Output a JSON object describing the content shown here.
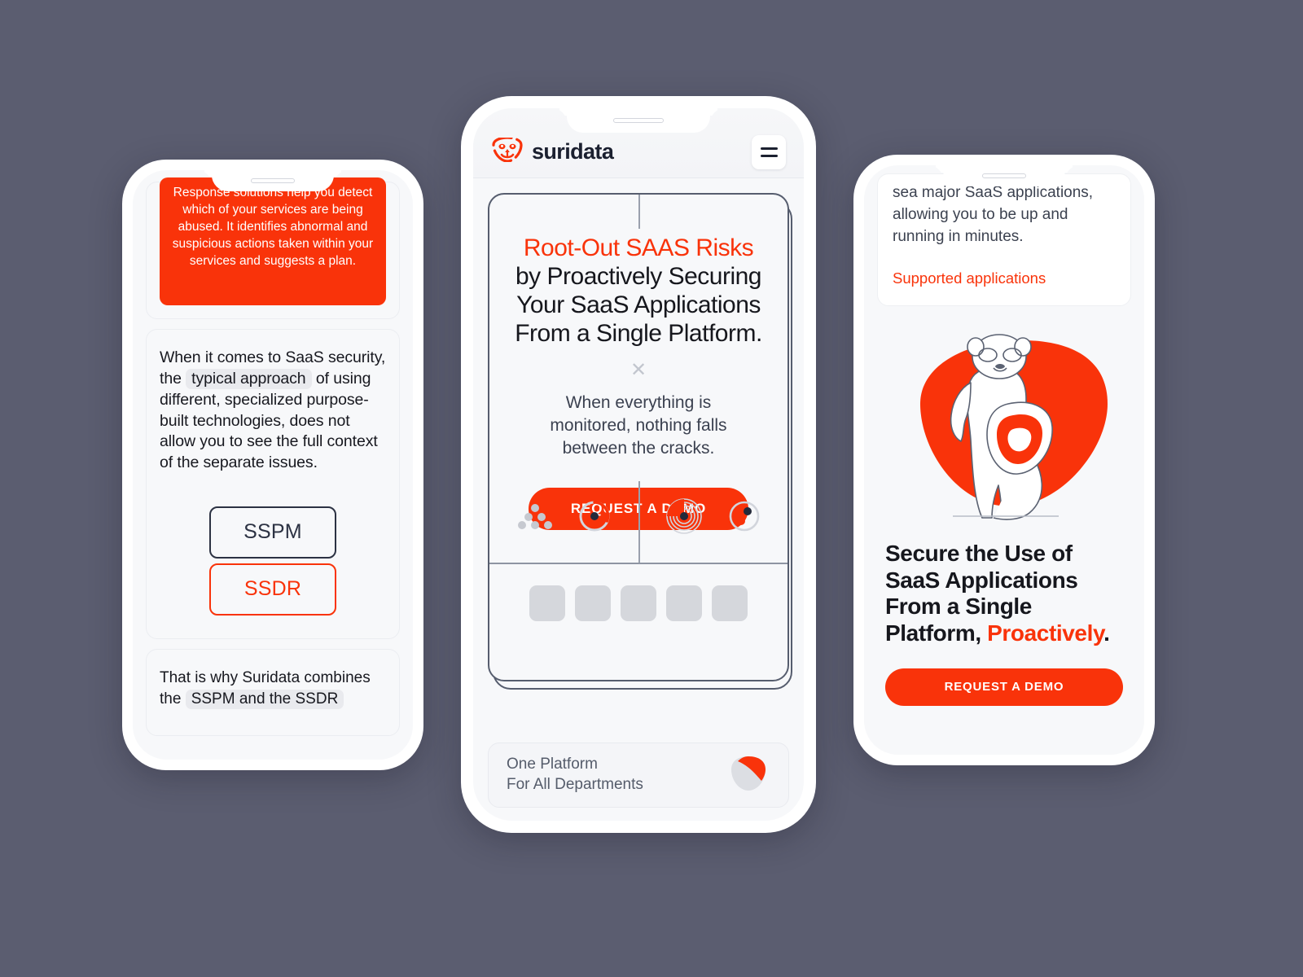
{
  "theme": {
    "background": "#5b5d70",
    "accent_red": "#f9330a",
    "ink": "#16171d",
    "muted": "#3b4150",
    "frame": "#565d6e"
  },
  "phones": {
    "left": {
      "red_card_text": "Response solutions help you detect which of your services are being abused. It identifies abnormal and suspicious actions taken within your  services and suggests a plan.",
      "body": {
        "part1": "When it comes to SaaS security, the",
        "chip": "typical approach",
        "part2": "of using different, specialized purpose-built technologies, does not allow you to see the full context of the separate issues."
      },
      "pills": [
        {
          "label": "SSPM",
          "style": "dark"
        },
        {
          "label": "SSDR",
          "style": "red"
        }
      ],
      "footer": {
        "part1": "That is why Suridata combines the",
        "chip": "SSPM and the SSDR"
      }
    },
    "center": {
      "header": {
        "brand_name": "suridata",
        "logo_icon": "suridata-meerkat-logo",
        "menu_icon": "hamburger-menu-icon"
      },
      "hero": {
        "headline_highlight": "Root-Out SAAS Risks",
        "headline_rest": " by Proactively Securing Your SaaS Applications From a Single Platform.",
        "divider_icon": "close-x-icon",
        "subhead": "When everything is monitored, nothing falls between the cracks.",
        "cta_label": "REQUEST A DEMO"
      },
      "widget_icons": [
        "dot-cluster-icon",
        "progress-ring-icon",
        "radar-rings-icon",
        "two-dot-ring-icon"
      ],
      "app_tiles": 5,
      "footer": {
        "line1": "One Platform",
        "line2": "For All Departments",
        "shield_icon": "suridata-shield-icon"
      }
    },
    "right": {
      "top_card": {
        "text": "sea    major SaaS applications, allowing you to be up and running in minutes.",
        "link_label": "Supported applications"
      },
      "art_icon": "meerkat-with-shield-illustration",
      "headline_part1": "Secure the Use of SaaS Applications From a Single Platform, ",
      "headline_highlight": "Proactively",
      "headline_part2": ".",
      "cta_label": "REQUEST A DEMO"
    }
  }
}
